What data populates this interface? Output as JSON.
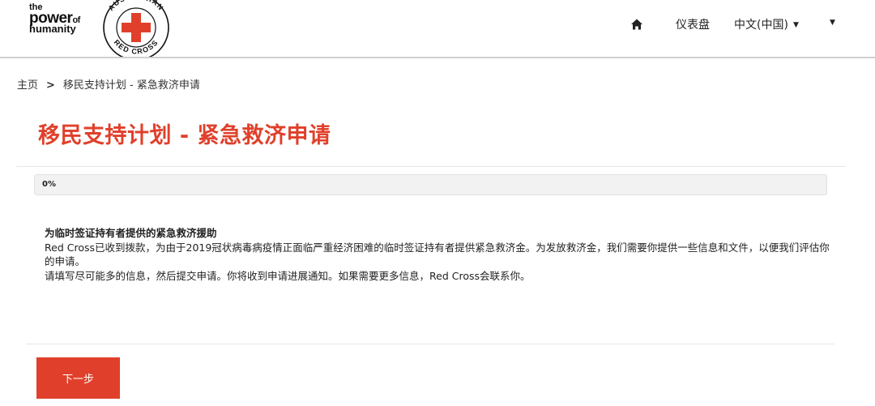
{
  "brand": {
    "tag_the": "the",
    "tag_power": "power",
    "tag_of": "of",
    "tag_humanity": "humanity",
    "emblem_text_top": "AUSTRALIAN",
    "emblem_text_bottom": "RED CROSS",
    "emblem_icon": "red-cross-icon",
    "accent_color": "#e0402b"
  },
  "nav": {
    "home_icon": "home-icon",
    "dashboard": "仪表盘",
    "language": "中文(中国)",
    "extra_caret": "▾"
  },
  "breadcrumb": {
    "home": "主页",
    "separator": ">",
    "current": "移民支持计划 - 紧急救济申请"
  },
  "page": {
    "title": "移民支持计划 - 紧急救济申请"
  },
  "progress": {
    "value": 0,
    "label": "0%"
  },
  "content": {
    "heading": "为临时签证持有者提供的紧急救济援助",
    "paragraph1": "Red Cross已收到拨款，为由于2019冠状病毒病疫情正面临严重经济困难的临时签证持有者提供紧急救济金。为发放救济金，我们需要你提供一些信息和文件，以便我们评估你的申请。",
    "paragraph2": "请填写尽可能多的信息，然后提交申请。你将收到申请进展通知。如果需要更多信息，Red Cross会联系你。"
  },
  "actions": {
    "next": "下一步"
  }
}
